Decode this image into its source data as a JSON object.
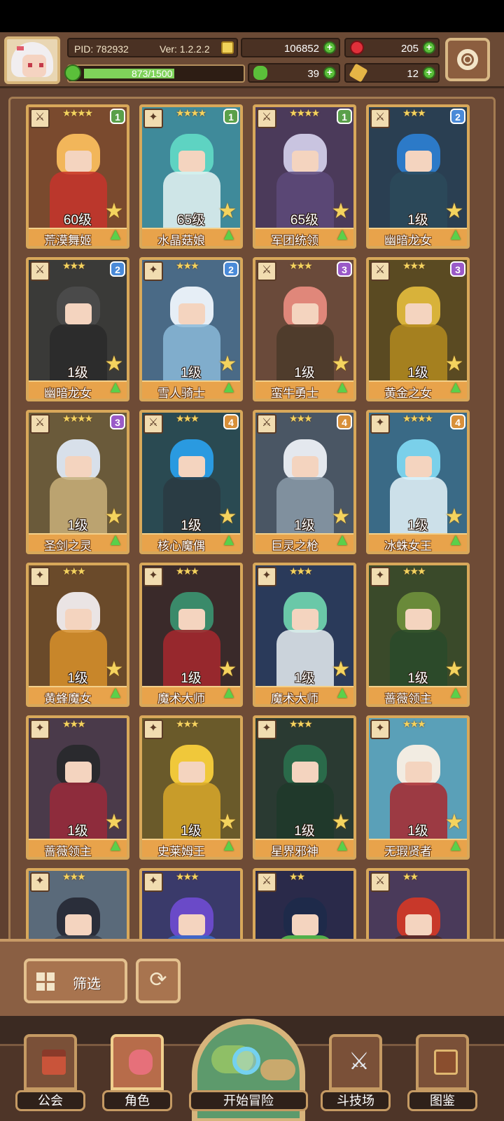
{
  "header": {
    "pid": "PID: 782932",
    "version": "Ver: 1.2.2.2",
    "gold": "106852",
    "gems": "205",
    "exp": "873/1500",
    "exp_fraction": 0.582,
    "clovers": "39",
    "keys": "12"
  },
  "cards": [
    {
      "name": "荒漠舞姬",
      "level": "60级",
      "stars": "★★★★",
      "tier": "1",
      "tier_color": "#5aa04a",
      "hair": "#f2b65a",
      "outfit": "#c7342c",
      "bg": "#7a4a2e",
      "weapon": "⚔"
    },
    {
      "name": "水晶菇娘",
      "level": "65级",
      "stars": "★★★★",
      "tier": "1",
      "tier_color": "#5aa04a",
      "hair": "#5ed3c2",
      "outfit": "#e8f4f4",
      "bg": "#3f8a9a",
      "weapon": "✦"
    },
    {
      "name": "军团统领",
      "level": "65级",
      "stars": "★★★★",
      "tier": "1",
      "tier_color": "#5aa04a",
      "hair": "#c9c4e0",
      "outfit": "#5d4a7a",
      "bg": "#4b3a5a",
      "weapon": "⚔"
    },
    {
      "name": "幽暗龙女",
      "level": "1级",
      "stars": "★★★",
      "tier": "2",
      "tier_color": "#4a8ad8",
      "hair": "#2c7ac8",
      "outfit": "#2c4a5a",
      "bg": "#2a3f52",
      "weapon": "⚔"
    },
    {
      "name": "幽暗龙女",
      "level": "1级",
      "stars": "★★★",
      "tier": "2",
      "tier_color": "#4a8ad8",
      "hair": "#4a4a4a",
      "outfit": "#2a2a2a",
      "bg": "#3a3a38",
      "weapon": "⚔"
    },
    {
      "name": "雪人骑士",
      "level": "1级",
      "stars": "★★★",
      "tier": "2",
      "tier_color": "#4a8ad8",
      "hair": "#e6eef6",
      "outfit": "#8ab8d8",
      "bg": "#4a6a86",
      "weapon": "✦"
    },
    {
      "name": "蛮牛勇士",
      "level": "1级",
      "stars": "★★★",
      "tier": "3",
      "tier_color": "#9a5ac8",
      "hair": "#e0877a",
      "outfit": "#4a3a2a",
      "bg": "#6a4a3a",
      "weapon": "⚔"
    },
    {
      "name": "黄金之女",
      "level": "1级",
      "stars": "★★★",
      "tier": "3",
      "tier_color": "#9a5ac8",
      "hair": "#d8b23a",
      "outfit": "#b38a1e",
      "bg": "#5a4a22",
      "weapon": "⚔"
    },
    {
      "name": "圣剑之灵",
      "level": "1级",
      "stars": "★★★★",
      "tier": "3",
      "tier_color": "#9a5ac8",
      "hair": "#d8e0ea",
      "outfit": "#c9b07a",
      "bg": "#6a5a3a",
      "weapon": "⚔"
    },
    {
      "name": "核心魔偶",
      "level": "1级",
      "stars": "★★★",
      "tier": "4",
      "tier_color": "#d8903a",
      "hair": "#2a9ae0",
      "outfit": "#2a3a42",
      "bg": "#2a4a52",
      "weapon": "⚔"
    },
    {
      "name": "巨灵之枪",
      "level": "1级",
      "stars": "★★★",
      "tier": "4",
      "tier_color": "#d8903a",
      "hair": "#e4e8ee",
      "outfit": "#8a9aa8",
      "bg": "#4a5664",
      "weapon": "⚔"
    },
    {
      "name": "冰蛛女王",
      "level": "1级",
      "stars": "★★★★",
      "tier": "4",
      "tier_color": "#d8903a",
      "hair": "#7ad0ea",
      "outfit": "#e6f4fa",
      "bg": "#3a6a86",
      "weapon": "✦"
    },
    {
      "name": "黄蜂魔女",
      "level": "1级",
      "stars": "★★★",
      "tier": "",
      "tier_color": "",
      "hair": "#eae4e4",
      "outfit": "#d8902a",
      "bg": "#6a4a2a",
      "weapon": "✦"
    },
    {
      "name": "魔术大师",
      "level": "1级",
      "stars": "★★★",
      "tier": "",
      "tier_color": "",
      "hair": "#3a8a6a",
      "outfit": "#a8282e",
      "bg": "#3a2a2a",
      "weapon": "✦"
    },
    {
      "name": "魔术大师",
      "level": "1级",
      "stars": "★★★",
      "tier": "",
      "tier_color": "",
      "hair": "#6ac8a8",
      "outfit": "#e8eef2",
      "bg": "#2a3a5a",
      "weapon": "✦"
    },
    {
      "name": "蔷薇领主",
      "level": "1级",
      "stars": "★★★",
      "tier": "",
      "tier_color": "",
      "hair": "#6a8a3a",
      "outfit": "#2a4a2a",
      "bg": "#3a4a2a",
      "weapon": "✦"
    },
    {
      "name": "蔷薇领主",
      "level": "1级",
      "stars": "★★★",
      "tier": "",
      "tier_color": "",
      "hair": "#2a2a2e",
      "outfit": "#9a2a3a",
      "bg": "#4a3a4a",
      "weapon": "✦"
    },
    {
      "name": "史莱姆王",
      "level": "1级",
      "stars": "★★★",
      "tier": "",
      "tier_color": "",
      "hair": "#f0c83a",
      "outfit": "#d8a82a",
      "bg": "#6a5a2a",
      "weapon": "✦"
    },
    {
      "name": "星界邪神",
      "level": "1级",
      "stars": "★★★",
      "tier": "",
      "tier_color": "",
      "hair": "#2a6a4a",
      "outfit": "#1e3a2a",
      "bg": "#2a3a32",
      "weapon": "✦"
    },
    {
      "name": "无瑕贤者",
      "level": "1级",
      "stars": "★★★",
      "tier": "",
      "tier_color": "",
      "hair": "#f2ece2",
      "outfit": "#a8282e",
      "bg": "#5aa0b8",
      "weapon": "✦"
    },
    {
      "name": "",
      "level": "",
      "stars": "★★★",
      "tier": "",
      "tier_color": "",
      "hair": "#2a2e3a",
      "outfit": "#3a3e4a",
      "bg": "#5a6a7a",
      "weapon": "✦"
    },
    {
      "name": "",
      "level": "",
      "stars": "★★★",
      "tier": "",
      "tier_color": "",
      "hair": "#6a4ac8",
      "outfit": "#3a6ac8",
      "bg": "#3a3a6a",
      "weapon": "✦"
    },
    {
      "name": "",
      "level": "",
      "stars": "★★",
      "tier": "",
      "tier_color": "",
      "hair": "#1e2a4a",
      "outfit": "#5ac84a",
      "bg": "#2a2a4a",
      "weapon": "⚔"
    },
    {
      "name": "",
      "level": "",
      "stars": "★★",
      "tier": "",
      "tier_color": "",
      "hair": "#c8382a",
      "outfit": "#4a2a2a",
      "bg": "#4a3a5a",
      "weapon": "⚔"
    }
  ],
  "actions": {
    "filter_label": "筛选",
    "refresh_glyph": "⟳"
  },
  "nav": {
    "guild": "公会",
    "character": "角色",
    "adventure": "开始冒险",
    "arena": "斗技场",
    "codex": "图鉴"
  }
}
